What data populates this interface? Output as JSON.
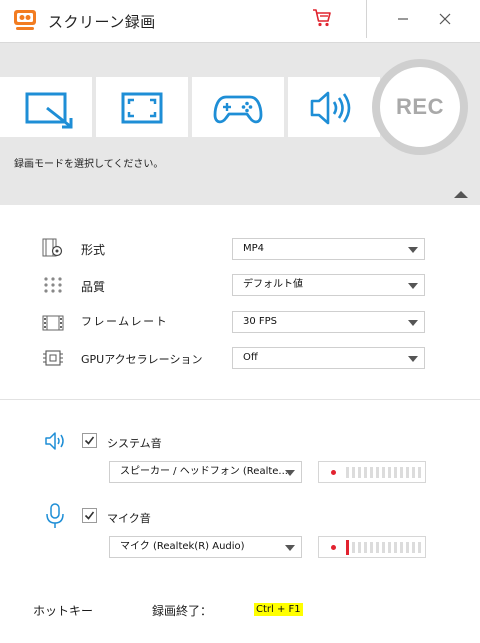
{
  "app": {
    "title": "スクリーン録画"
  },
  "colors": {
    "accent_blue": "#1e8ed6",
    "mode_panel_bg": "#e7e7e7",
    "rec_ring": "#cfcfcf",
    "rec_text": "#a9a9a9",
    "meter_dot": "#e2222f",
    "meter_peak": "#e2222f",
    "hotkey_highlight": "#ffff00"
  },
  "mode_panel": {
    "modes": [
      {
        "icon": "region-resize-icon"
      },
      {
        "icon": "fullscreen-icon"
      },
      {
        "icon": "gamepad-icon"
      },
      {
        "icon": "audio-speaker-icon"
      }
    ],
    "rec_label": "REC",
    "hint": "録画モードを選択してください。"
  },
  "settings": {
    "format": {
      "label": "形式",
      "value": "MP4",
      "icon": "format-film-gear-icon"
    },
    "quality": {
      "label": "品質",
      "value": "デフォルト値",
      "icon": "quality-dots-icon"
    },
    "framerate": {
      "label": "フレームレート",
      "value": "30 FPS",
      "icon": "filmstrip-icon"
    },
    "gpu": {
      "label": "GPUアクセラレーション",
      "value": "Off",
      "icon": "chip-icon"
    }
  },
  "audio": {
    "system": {
      "label": "システム音",
      "checked": true,
      "device": "スピーカー / ヘッドフォン (Realte...",
      "icon": "speaker-icon",
      "level": 0
    },
    "mic": {
      "label": "マイク音",
      "checked": true,
      "device": "マイク (Realtek(R) Audio)",
      "icon": "microphone-icon",
      "level": 0.06
    }
  },
  "hotkey": {
    "label": "ホットキー",
    "action": "録画終了：",
    "key": "Ctrl + F1"
  }
}
